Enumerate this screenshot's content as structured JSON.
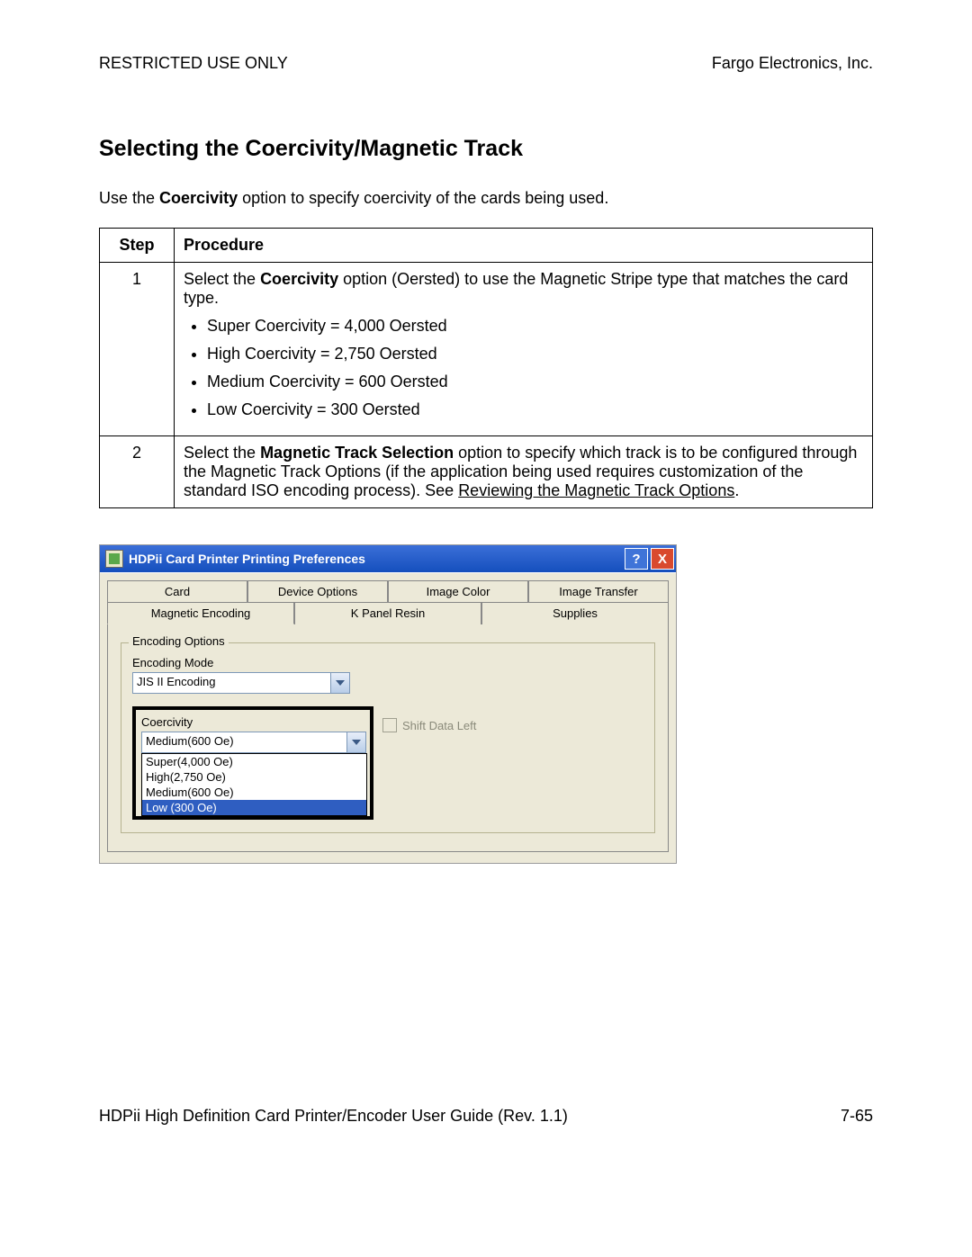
{
  "header": {
    "left": "RESTRICTED USE ONLY",
    "right": "Fargo Electronics, Inc."
  },
  "section_title": "Selecting the Coercivity/Magnetic Track",
  "intro_pre": "Use the ",
  "intro_bold": "Coercivity",
  "intro_post": " option to specify coercivity of the cards being used.",
  "table": {
    "head_step": "Step",
    "head_proc": "Procedure",
    "rows": [
      {
        "num": "1",
        "lead_pre": "Select the ",
        "lead_bold": "Coercivity",
        "lead_post": " option (Oersted) to use the Magnetic Stripe type that matches the card type.",
        "bullets": [
          "Super Coercivity = 4,000 Oersted",
          "High Coercivity = 2,750 Oersted",
          "Medium Coercivity = 600 Oersted",
          "Low Coercivity = 300 Oersted"
        ]
      },
      {
        "num": "2",
        "lead_pre": "Select the ",
        "lead_bold": "Magnetic Track Selection",
        "lead_post": " option to specify which track is to be configured through the Magnetic Track Options (if the application being used requires customization of the standard ISO encoding process). See ",
        "link": "Reviewing the Magnetic Track Options",
        "tail": "."
      }
    ]
  },
  "dialog": {
    "title": "HDPii Card Printer Printing Preferences",
    "tabs_back": [
      "Card",
      "Device Options",
      "Image Color",
      "Image Transfer"
    ],
    "tabs_front": [
      "Magnetic Encoding",
      "K Panel Resin",
      "Supplies"
    ],
    "group_title": "Encoding Options",
    "enc_mode_label": "Encoding Mode",
    "enc_mode_value": "JIS II Encoding",
    "coercivity_label": "Coercivity",
    "coercivity_value": "Medium(600 Oe)",
    "coercivity_options": [
      "Super(4,000 Oe)",
      "High(2,750 Oe)",
      "Medium(600 Oe)",
      "Low (300 Oe)"
    ],
    "coercivity_highlight_index": 3,
    "shift_label": "Shift Data Left"
  },
  "footer": {
    "left": "HDPii High Definition Card Printer/Encoder User Guide (Rev. 1.1)",
    "right": "7-65"
  }
}
